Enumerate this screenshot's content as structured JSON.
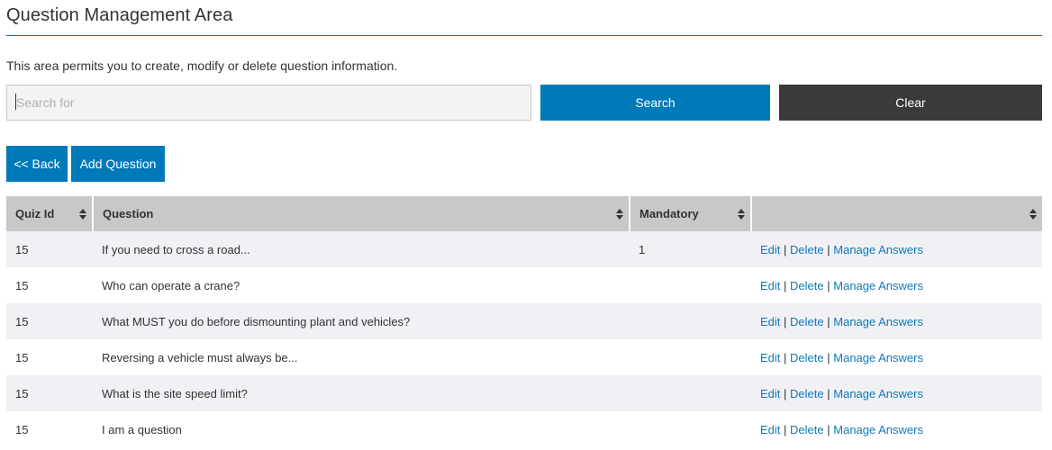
{
  "header": {
    "title": "Question Management Area",
    "description": "This area permits you to create, modify or delete question information."
  },
  "search": {
    "placeholder": "Search for",
    "value": "",
    "search_label": "Search",
    "clear_label": "Clear"
  },
  "actions": {
    "back_label": "<< Back",
    "add_label": "Add Question"
  },
  "colors": {
    "primary": "#0079b8",
    "dark": "#3a3a3a",
    "header_bg": "#c8c8c8",
    "link": "#0f7ab8"
  },
  "table": {
    "columns": [
      "Quiz Id",
      "Question",
      "Mandatory",
      ""
    ],
    "links": {
      "edit": "Edit",
      "delete": "Delete",
      "manage": "Manage Answers",
      "separator": "|"
    },
    "rows": [
      {
        "quiz_id": "15",
        "question": "If you need to cross a road...",
        "mandatory": "1"
      },
      {
        "quiz_id": "15",
        "question": "Who can operate a crane?",
        "mandatory": ""
      },
      {
        "quiz_id": "15",
        "question": "What MUST you do before dismounting plant and vehicles?",
        "mandatory": ""
      },
      {
        "quiz_id": "15",
        "question": "Reversing a vehicle must always be...",
        "mandatory": ""
      },
      {
        "quiz_id": "15",
        "question": "What is the site speed limit?",
        "mandatory": ""
      },
      {
        "quiz_id": "15",
        "question": "I am a question",
        "mandatory": ""
      }
    ]
  }
}
